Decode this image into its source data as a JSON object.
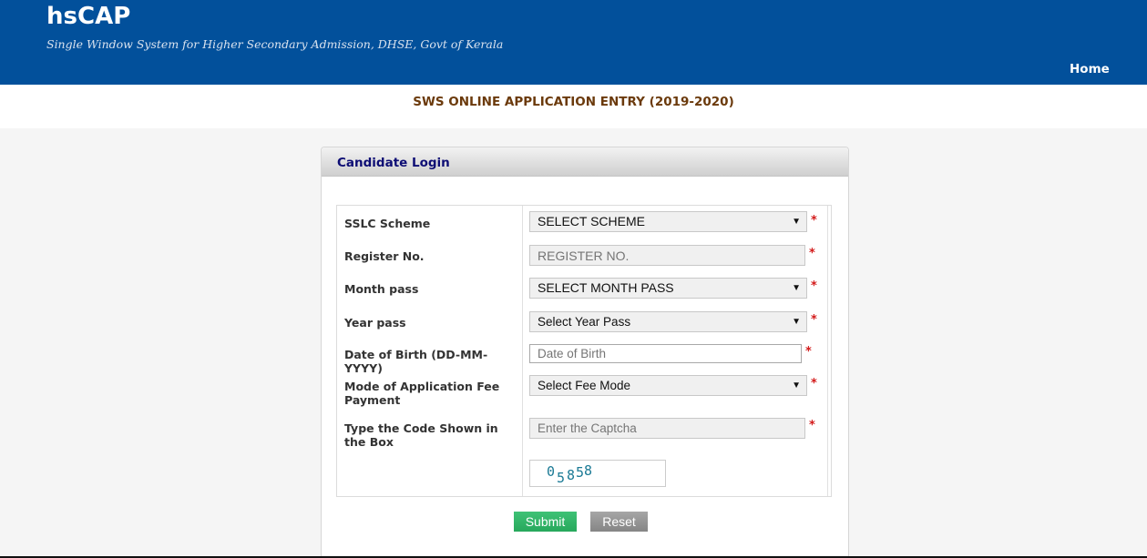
{
  "header": {
    "brand": "hsCAP",
    "tagline": "Single Window System for Higher Secondary Admission, DHSE, Govt of Kerala",
    "nav": {
      "home_label": "Home"
    }
  },
  "page": {
    "subtitle": "SWS ONLINE APPLICATION ENTRY (2019-2020)"
  },
  "login_panel": {
    "title": "Candidate Login",
    "required_marker": "*",
    "fields": [
      {
        "label": "SSLC Scheme",
        "type": "select",
        "value": "SELECT SCHEME"
      },
      {
        "label": "Register No.",
        "type": "input",
        "placeholder": "REGISTER NO."
      },
      {
        "label": "Month pass",
        "type": "select",
        "value": "SELECT MONTH PASS"
      },
      {
        "label": "Year pass",
        "type": "select",
        "value": "Select Year Pass"
      },
      {
        "label": "Date of Birth (DD-MM-YYYY)",
        "type": "input",
        "placeholder": "Date of Birth"
      },
      {
        "label": "Mode of Application Fee Payment",
        "type": "select",
        "value": "Select Fee Mode"
      },
      {
        "label": "Type the Code Shown in the Box",
        "type": "input",
        "placeholder": "Enter the Captcha"
      }
    ],
    "captcha": {
      "chars": [
        "0",
        "5",
        "8",
        "5",
        "8"
      ]
    },
    "select_arrow": "▼",
    "buttons": {
      "submit": "Submit",
      "reset": "Reset"
    },
    "colors": {
      "submit": "#2fb468",
      "reset": "#959595",
      "required": "#d31a1a",
      "header": "#02509b"
    }
  }
}
